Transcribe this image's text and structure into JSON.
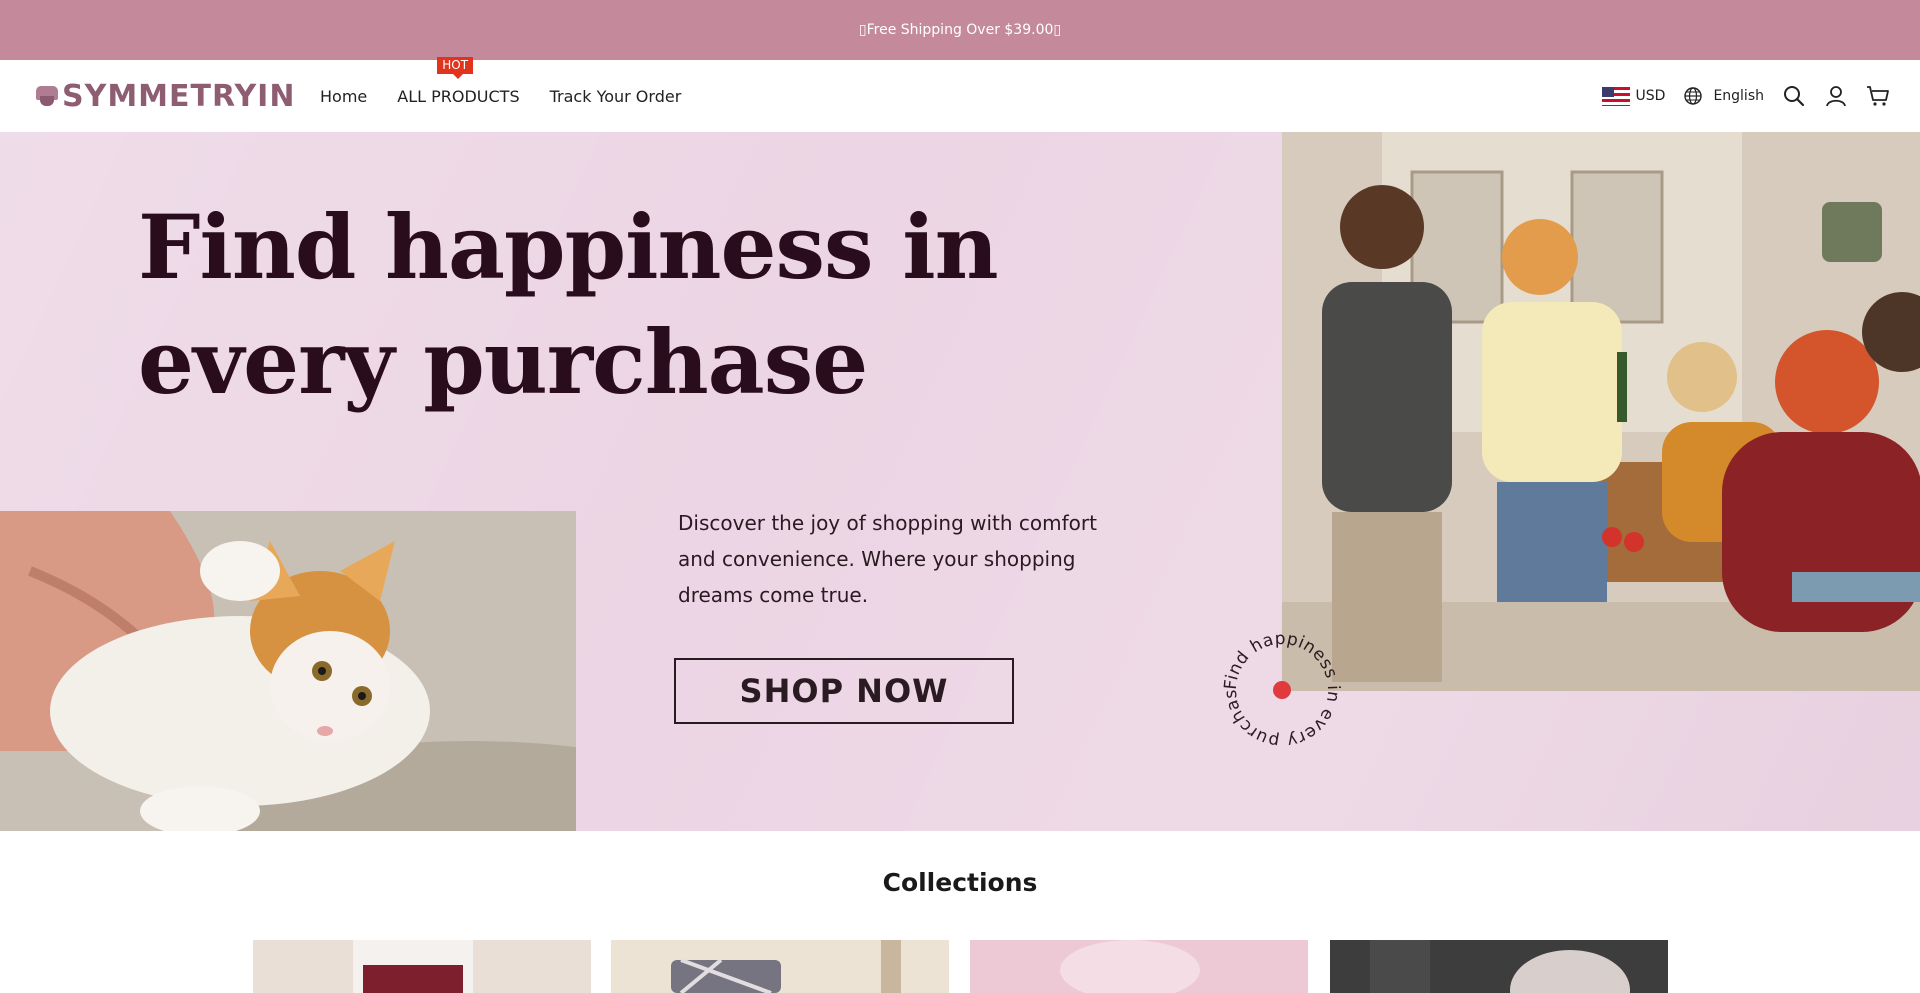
{
  "announcement": {
    "text": "▯Free Shipping Over $39.00▯"
  },
  "header": {
    "logo_text": "SYMMETRYIN",
    "nav": [
      {
        "label": "Home"
      },
      {
        "label": "ALL PRODUCTS",
        "badge": "HOT"
      },
      {
        "label": "Track Your Order"
      }
    ],
    "currency": "USD",
    "language": "English",
    "icons": [
      "search-icon",
      "account-icon",
      "cart-icon",
      "globe-icon",
      "us-flag-icon"
    ]
  },
  "hero": {
    "title_line1": "Find happiness in",
    "title_line2": "every purchase",
    "subtitle": "Discover the joy of shopping with comfort and convenience. Where your shopping dreams come true.",
    "cta": "SHOP NOW",
    "badge_text": "Find happiness in every purchase"
  },
  "collections": {
    "title": "Collections"
  },
  "colors": {
    "announcement_bg": "#c48a9c",
    "hero_bg": "#ecd5e4",
    "title": "#2a0d1c",
    "logo": "#8e5d72",
    "hot_badge": "#e0341e",
    "badge_dot": "#e03a3e"
  }
}
